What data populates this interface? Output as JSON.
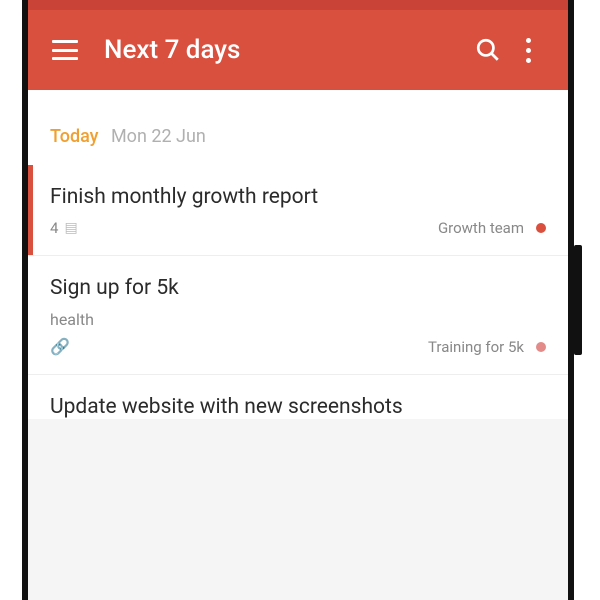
{
  "header": {
    "title": "Next 7 days"
  },
  "section": {
    "today_label": "Today",
    "date": "Mon 22 Jun"
  },
  "tasks": [
    {
      "title": "Finish monthly growth report",
      "comment_count": "4",
      "project": "Growth team"
    },
    {
      "title": "Sign up for 5k",
      "tag": "health",
      "project": "Training for 5k"
    },
    {
      "title": "Update website with new screenshots"
    }
  ]
}
